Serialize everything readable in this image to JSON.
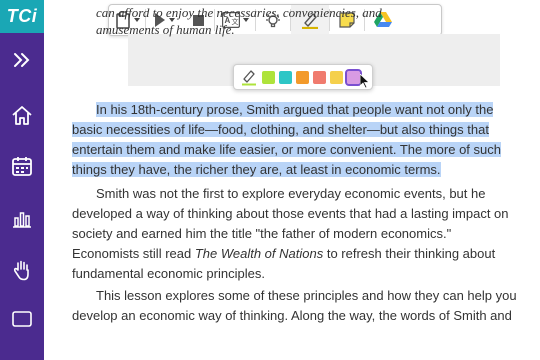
{
  "brand": {
    "logo_text": "TCi",
    "logo_color": "#1aa7b5"
  },
  "sidebar": {
    "color": "#4b2b8f",
    "items": [
      {
        "icon": "chevrons-right-icon"
      },
      {
        "icon": "home-icon"
      },
      {
        "icon": "calendar-icon"
      },
      {
        "icon": "bar-chart-icon"
      },
      {
        "icon": "hand-icon"
      }
    ]
  },
  "toolbar": {
    "items": [
      "clipboard-icon",
      "play-icon",
      "stop-icon",
      "translate-icon",
      "lightbulb-icon",
      "highlighter-icon",
      "sticky-note-icon",
      "google-drive-icon"
    ]
  },
  "highlight_popup": {
    "colors": [
      "#aee33b",
      "#2ec6c6",
      "#f39a2b",
      "#f07b6e",
      "#f5d04c",
      "#d89be3"
    ],
    "selected_index": 5
  },
  "content": {
    "quote_lines": [
      "can afford to enjoy the necessaries, conveniencies, and",
      "amusements of human life."
    ],
    "paragraph1_lines": [
      "In his 18th-century prose, Smith argued that people want not only the",
      "basic necessities of life—food, clothing, and shelter—but also things that",
      "entertain them and make life easier, or more convenient. The more of such",
      "things they have, the richer they are, at least in economic terms."
    ],
    "paragraph2_lines": [
      "Smith was not the first to explore everyday economic events, but he",
      "developed a way of thinking about those events that had a lasting impact on",
      "society and earned him the title \"the father of modern economics.\""
    ],
    "paragraph2_line4_pre": "Economists still read ",
    "paragraph2_line4_title": "The Wealth of Nations",
    "paragraph2_line4_post": " to refresh their thinking about",
    "paragraph2_line5": "fundamental economic principles.",
    "paragraph3_lines": [
      "This lesson explores some of these principles and how they can help you",
      "develop an economic way of thinking. Along the way, the words of Smith and"
    ]
  }
}
